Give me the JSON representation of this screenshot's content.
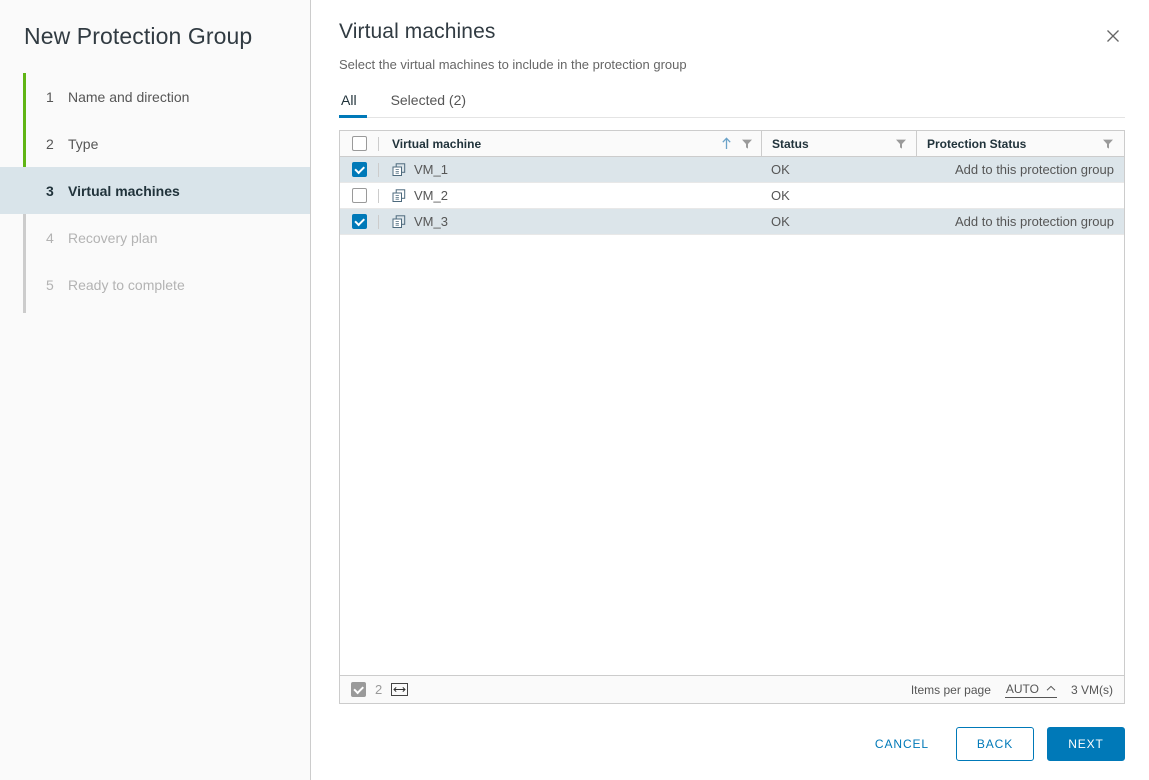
{
  "wizard": {
    "title": "New Protection Group",
    "steps": [
      {
        "num": "1",
        "label": "Name and direction",
        "state": "done"
      },
      {
        "num": "2",
        "label": "Type",
        "state": "done"
      },
      {
        "num": "3",
        "label": "Virtual machines",
        "state": "active"
      },
      {
        "num": "4",
        "label": "Recovery plan",
        "state": "disabled"
      },
      {
        "num": "5",
        "label": "Ready to complete",
        "state": "disabled"
      }
    ]
  },
  "header": {
    "title": "Virtual machines",
    "subtitle": "Select the virtual machines to include in the protection group",
    "close_icon": "close-icon"
  },
  "tabs": [
    {
      "label": "All",
      "active": true
    },
    {
      "label": "Selected (2)",
      "active": false
    }
  ],
  "table": {
    "columns": {
      "virtual_machine": "Virtual machine",
      "status": "Status",
      "protection_status": "Protection Status"
    },
    "sort": {
      "column": "Virtual machine",
      "direction": "ascending",
      "icon": "sort-arrow-up-icon"
    },
    "filter_icon": "filter-funnel-icon",
    "select_all_checked": false,
    "rows": [
      {
        "name": "VM_1",
        "icon": "virtual-machine-icon",
        "status": "OK",
        "protection_status": "Add to this protection group",
        "selected": true
      },
      {
        "name": "VM_2",
        "icon": "virtual-machine-icon",
        "status": "OK",
        "protection_status": "",
        "selected": false
      },
      {
        "name": "VM_3",
        "icon": "virtual-machine-icon",
        "status": "OK",
        "protection_status": "Add to this protection group",
        "selected": true
      }
    ]
  },
  "table_footer": {
    "selected_count": "2",
    "fit_icon": "fit-columns-icon",
    "items_per_page_label": "Items per page",
    "items_per_page_value": "AUTO",
    "caret_icon": "chevron-up-icon",
    "total_label": "3 VM(s)"
  },
  "actions": {
    "cancel": "CANCEL",
    "back": "BACK",
    "next": "NEXT"
  },
  "colors": {
    "accent": "#0079b8",
    "progress_green": "#60b515",
    "selected_row": "#dce5ea",
    "active_step": "#d9e4ea"
  }
}
